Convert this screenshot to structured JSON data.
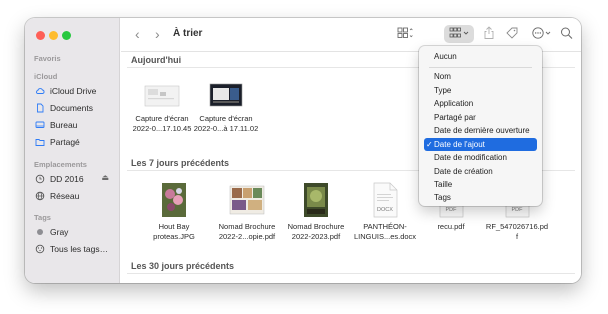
{
  "sidebar": {
    "favoris_label": "Favoris",
    "icloud_label": "iCloud",
    "icloud_items": [
      {
        "label": "iCloud Drive",
        "icon": "cloud-icon"
      },
      {
        "label": "Documents",
        "icon": "document-icon"
      },
      {
        "label": "Bureau",
        "icon": "desktop-icon"
      },
      {
        "label": "Partagé",
        "icon": "shared-folder-icon"
      }
    ],
    "emplacements_label": "Emplacements",
    "locations": [
      {
        "label": "DD 2016",
        "icon": "clock-drive-icon"
      },
      {
        "label": "Réseau",
        "icon": "globe-icon"
      }
    ],
    "tags_label": "Tags",
    "tags": [
      {
        "label": "Gray",
        "icon": "gray-dot-icon"
      },
      {
        "label": "Tous les tags…",
        "icon": "all-tags-icon"
      }
    ]
  },
  "toolbar": {
    "back": "‹",
    "forward": "›",
    "title": "À trier"
  },
  "sections": [
    {
      "title": "Aujourd'hui",
      "files": [
        {
          "name": "Capture d'écran\n2022-0...17.10.45"
        },
        {
          "name": "Capture d'écran\n2022-0...à 17.11.02"
        }
      ]
    },
    {
      "title": "Les 7 jours précédents",
      "files": [
        {
          "name": "Hout Bay\nproteas.JPG"
        },
        {
          "name": "Nomad Brochure\n2022-2...opie.pdf"
        },
        {
          "name": "Nomad Brochure\n2022-2023.pdf"
        },
        {
          "name": "PANTHÉON-\nLINGUIS...es.docx",
          "badge": "DOCX"
        },
        {
          "name": "recu.pdf",
          "badge": "PDF"
        },
        {
          "name": "RF_547026716.pd\nf",
          "badge": "PDF"
        }
      ]
    },
    {
      "title": "Les 30 jours précédents",
      "files": []
    }
  ],
  "menu": {
    "items": [
      "Aucun",
      "Nom",
      "Type",
      "Application",
      "Partagé par",
      "Date de dernière ouverture",
      "Date de l'ajout",
      "Date de modification",
      "Date de création",
      "Taille",
      "Tags"
    ],
    "selected": "Date de l'ajout",
    "checkmark": "✓"
  },
  "colors": {
    "accent": "#1f6ce0",
    "sidebar_bg": "#e9e7ea",
    "sidebar_icon": "#2f7cf6"
  }
}
